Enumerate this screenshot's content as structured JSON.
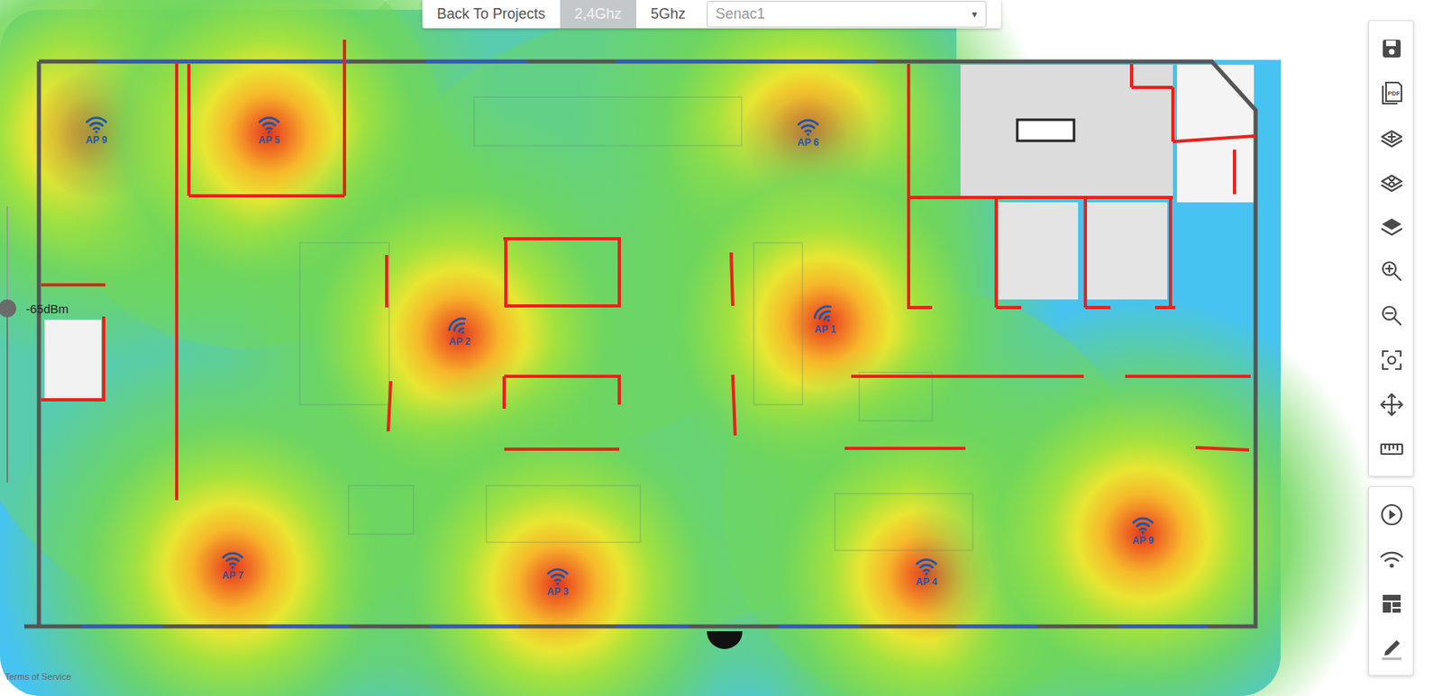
{
  "topbar": {
    "back": "Back To Projects",
    "bands": [
      {
        "label": "2,4Ghz",
        "selected": true
      },
      {
        "label": "5Ghz",
        "selected": false
      }
    ],
    "project_select": {
      "value": "Senac1",
      "arrow": "▾"
    }
  },
  "threshold": {
    "reading": "-65dBm",
    "level": 0.63
  },
  "access_points": [
    {
      "label": "AP 9",
      "kind": "standard"
    },
    {
      "label": "AP 5",
      "kind": "standard"
    },
    {
      "label": "AP 6",
      "kind": "standard"
    },
    {
      "label": "AP 2",
      "kind": "tilted"
    },
    {
      "label": "AP 1",
      "kind": "tilted"
    },
    {
      "label": "AP 7",
      "kind": "standard"
    },
    {
      "label": "AP 3",
      "kind": "standard"
    },
    {
      "label": "AP 4",
      "kind": "standard"
    },
    {
      "label": "AP 9",
      "kind": "standard"
    }
  ],
  "toolbar": {
    "pdf_text": "PDF"
  },
  "footer": {
    "terms": "Terms of Service"
  }
}
